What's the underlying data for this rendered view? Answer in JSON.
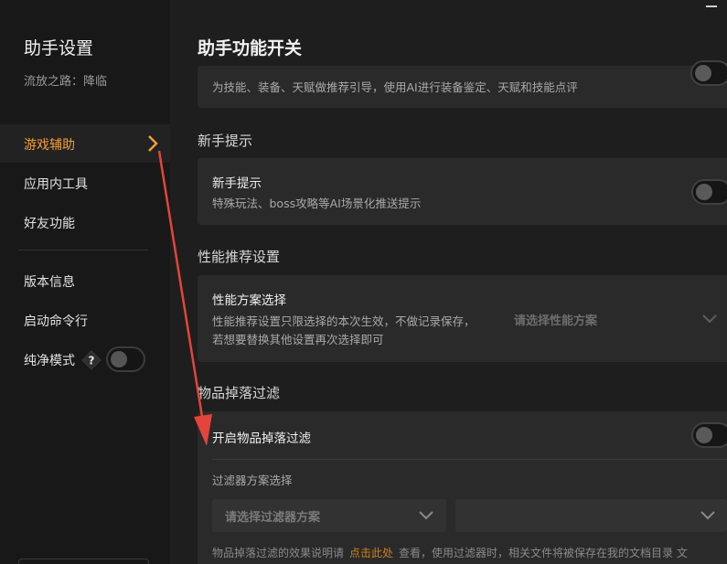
{
  "sidebar": {
    "title": "助手设置",
    "subtitle": "流放之路：降临",
    "items": [
      {
        "label": "游戏辅助",
        "active": true
      },
      {
        "label": "应用内工具"
      },
      {
        "label": "好友功能"
      },
      {
        "label": "版本信息"
      },
      {
        "label": "启动命令行"
      },
      {
        "label": "纯净模式"
      }
    ],
    "help_glyph": "?"
  },
  "main": {
    "title": "助手功能开关",
    "ai_card": {
      "desc": "为技能、装备、天赋做推荐引导，使用AI进行装备鉴定、天赋和技能点评"
    },
    "newbie": {
      "section": "新手提示",
      "card_title": "新手提示",
      "card_desc": "特殊玩法、boss攻略等AI场景化推送提示"
    },
    "perf": {
      "section": "性能推荐设置",
      "card_title": "性能方案选择",
      "card_desc_1": "性能推荐设置只限选择的本次生效，不做记录保存，",
      "card_desc_2": "若想要替换其他设置再次选择即可",
      "select_placeholder": "请选择性能方案"
    },
    "filter": {
      "section": "物品掉落过滤",
      "toggle_label": "开启物品掉落过滤",
      "scheme_label": "过滤器方案选择",
      "select1_placeholder": "请选择过滤器方案",
      "note_pre": "物品掉落过滤的效果说明请",
      "note_link": "点击此处",
      "note_post": "查看，使用过滤器时，相关文件将被保存在我的文档目录 文"
    }
  },
  "colors": {
    "accent": "#f5a03a",
    "annotation": "#e5443a"
  }
}
